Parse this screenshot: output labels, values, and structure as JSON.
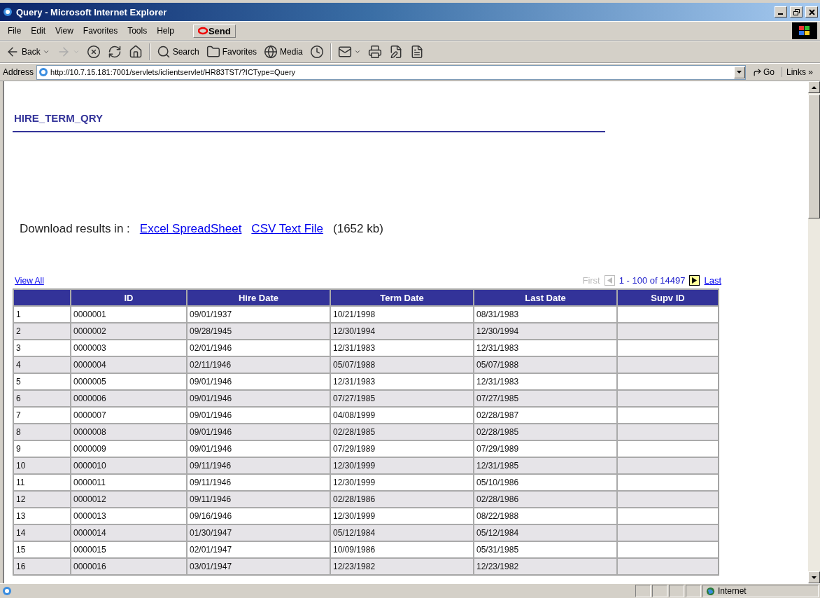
{
  "window": {
    "title": "Query - Microsoft Internet Explorer"
  },
  "menu": [
    {
      "label": "File"
    },
    {
      "label": "Edit"
    },
    {
      "label": "View"
    },
    {
      "label": "Favorites"
    },
    {
      "label": "Tools"
    },
    {
      "label": "Help"
    }
  ],
  "send_button": {
    "label": "Send"
  },
  "toolbar": [
    {
      "kind": "back",
      "label": "Back",
      "disabled": false
    },
    {
      "kind": "forward",
      "disabled": true
    },
    {
      "kind": "stop",
      "disabled": false
    },
    {
      "kind": "refresh",
      "disabled": false
    },
    {
      "kind": "home",
      "disabled": false
    },
    {
      "kind": "search",
      "label": "Search",
      "disabled": false
    },
    {
      "kind": "favorites",
      "label": "Favorites",
      "disabled": false
    },
    {
      "kind": "media",
      "label": "Media",
      "disabled": false
    },
    {
      "kind": "history",
      "disabled": false
    },
    {
      "kind": "mail",
      "disabled": false
    },
    {
      "kind": "print",
      "disabled": false
    },
    {
      "kind": "edit",
      "disabled": false
    },
    {
      "kind": "discuss",
      "disabled": false
    }
  ],
  "address_bar": {
    "label": "Address",
    "url": "http://10.7.15.181:7001/servlets/iclientservlet/HR83TST/?ICType=Query",
    "go": "Go",
    "links": "Links",
    "more": "»"
  },
  "page": {
    "heading": "HIRE_TERM_QRY",
    "download": {
      "prefix": "Download results in :",
      "links": [
        {
          "label": "Excel SpreadSheet"
        },
        {
          "label": "CSV Text File"
        }
      ],
      "size": "(1652 kb)"
    },
    "view_all": "View All",
    "pager": {
      "first": {
        "label": "First",
        "disabled": true
      },
      "previous": {
        "disabled": true
      },
      "range": "1 - 100 of 14497",
      "next": {
        "disabled": false
      },
      "last": {
        "label": "Last",
        "disabled": false
      }
    },
    "table": {
      "columns": [
        "ID",
        "Hire Date",
        "Term Date",
        "Last Date",
        "Supv ID"
      ],
      "rows": [
        {
          "row": "1",
          "cells": [
            "0000001",
            "09/01/1937",
            "10/21/1998",
            "08/31/1983"
          ]
        },
        {
          "row": "2",
          "cells": [
            "0000002",
            "09/28/1945",
            "12/30/1994",
            "12/30/1994"
          ]
        },
        {
          "row": "3",
          "cells": [
            "0000003",
            "02/01/1946",
            "12/31/1983",
            "12/31/1983"
          ]
        },
        {
          "row": "4",
          "cells": [
            "0000004",
            "02/11/1946",
            "05/07/1988",
            "05/07/1988"
          ]
        },
        {
          "row": "5",
          "cells": [
            "0000005",
            "09/01/1946",
            "12/31/1983",
            "12/31/1983"
          ]
        },
        {
          "row": "6",
          "cells": [
            "0000006",
            "09/01/1946",
            "07/27/1985",
            "07/27/1985"
          ]
        },
        {
          "row": "7",
          "cells": [
            "0000007",
            "09/01/1946",
            "04/08/1999",
            "02/28/1987"
          ]
        },
        {
          "row": "8",
          "cells": [
            "0000008",
            "09/01/1946",
            "02/28/1985",
            "02/28/1985"
          ]
        },
        {
          "row": "9",
          "cells": [
            "0000009",
            "09/01/1946",
            "07/29/1989",
            "07/29/1989"
          ]
        },
        {
          "row": "10",
          "cells": [
            "0000010",
            "09/11/1946",
            "12/30/1999",
            "12/31/1985"
          ]
        },
        {
          "row": "11",
          "cells": [
            "0000011",
            "09/11/1946",
            "12/30/1999",
            "05/10/1986"
          ]
        },
        {
          "row": "12",
          "cells": [
            "0000012",
            "09/11/1946",
            "02/28/1986",
            "02/28/1986"
          ]
        },
        {
          "row": "13",
          "cells": [
            "0000013",
            "09/16/1946",
            "12/30/1999",
            "08/22/1988"
          ]
        },
        {
          "row": "14",
          "cells": [
            "0000014",
            "01/30/1947",
            "05/12/1984",
            "05/12/1984"
          ]
        },
        {
          "row": "15",
          "cells": [
            "0000015",
            "02/01/1947",
            "10/09/1986",
            "05/31/1985"
          ]
        },
        {
          "row": "16",
          "cells": [
            "0000016",
            "03/01/1947",
            "12/23/1982",
            "12/23/1982"
          ]
        }
      ]
    }
  },
  "status_bar": {
    "zone": "Internet"
  }
}
